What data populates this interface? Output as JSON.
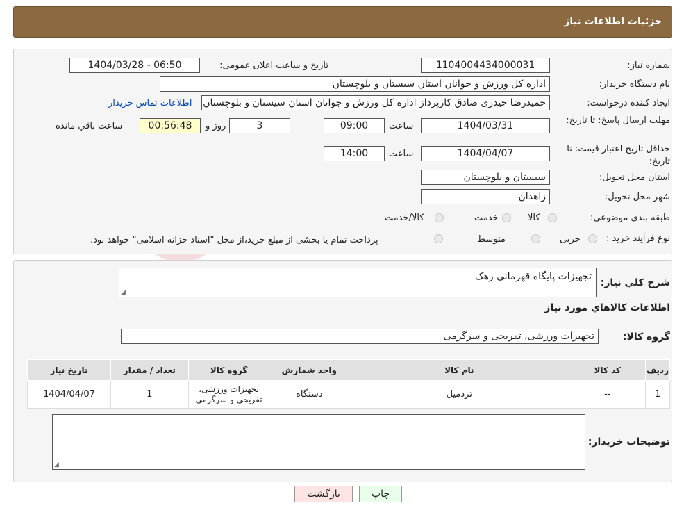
{
  "header": {
    "title": "جزئیات اطلاعات نیاز"
  },
  "fields": {
    "need_number_label": "شماره نیاز:",
    "need_number": "1104004434000031",
    "announce_label": "تاریخ و ساعت اعلان عمومی:",
    "announce_value": "1404/03/28 - 06:50",
    "buyer_org_label": "نام دستگاه خریدار:",
    "buyer_org": "اداره کل ورزش و جوانان استان سیستان و بلوچستان",
    "requester_label": "ایجاد کننده درخواست:",
    "requester": "حمیدرضا حیدری صادق کارپرداز اداره کل ورزش و جوانان استان سیستان و بلوچستان",
    "contact_link": "اطلاعات تماس خریدار",
    "deadline_label": "مهلت ارسال پاسخ: تا تاریخ:",
    "deadline_date": "1404/03/31",
    "time_label": "ساعت",
    "deadline_time": "09:00",
    "days_value": "3",
    "days_label": "روز و",
    "remaining_time": "00:56:48",
    "remaining_label": "ساعت باقي مانده",
    "validity_label": "حداقل تاریخ اعتبار قیمت: تا تاریخ:",
    "validity_date": "1404/04/07",
    "validity_time": "14:00",
    "province_label": "استان محل تحویل:",
    "province": "سیستان و بلوچستان",
    "city_label": "شهر محل تحویل:",
    "city": "زاهدان",
    "category_label": "طبقه بندی موضوعی:",
    "category_options": [
      "کالا",
      "خدمت",
      "کالا/خدمت"
    ],
    "process_label": "نوع فرآیند خرید :",
    "process_options": [
      "جزیی",
      "متوسط"
    ],
    "process_note": "پرداخت تمام یا بخشی از مبلغ خرید،از محل \"اسناد خزانه اسلامی\" خواهد بود."
  },
  "summary": {
    "desc_label": "شرح کلي نیاز:",
    "desc_value": "تجهیزات پایگاه قهرمانی زهک",
    "goods_info_title": "اطلاعات کالاهاي مورد نیاز",
    "goods_group_label": "گروه کالا:",
    "goods_group_value": "تجهیزات ورزشی، تفریحی و سرگرمی"
  },
  "table": {
    "headers": [
      "ردیف",
      "کد کالا",
      "نام کالا",
      "واحد شمارش",
      "گروه کالا",
      "تعداد / مقدار",
      "تاریخ نیاز"
    ],
    "rows": [
      [
        "1",
        "--",
        "تردمیل",
        "دستگاه",
        "تجهیزات ورزشی، تفریحی و سرگرمی",
        "1",
        "1404/04/07"
      ]
    ]
  },
  "buyer_notes_label": "توضیحات خریدار:",
  "buttons": {
    "print": "چاپ",
    "back": "بازگشت"
  },
  "colors": {
    "header_bg": "#8b6a41",
    "print_bg": "#eaffea",
    "back_bg": "#ffe4e4",
    "link": "#0645ad"
  }
}
